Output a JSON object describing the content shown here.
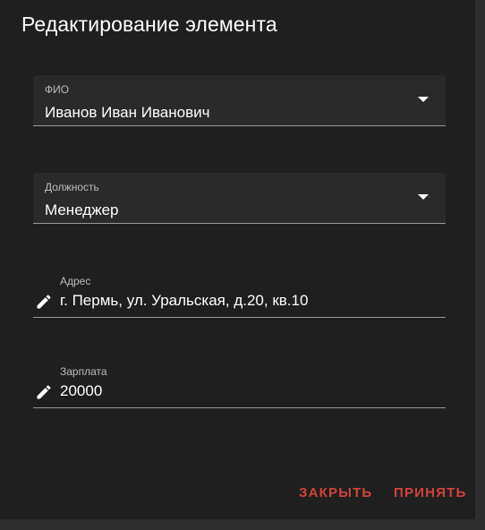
{
  "dialog": {
    "title": "Редактирование элемента"
  },
  "fields": {
    "fio": {
      "label": "ФИО",
      "value": "Иванов Иван Иванович"
    },
    "position": {
      "label": "Должность",
      "value": "Менеджер"
    },
    "address": {
      "label": "Адрес",
      "value": "г. Пермь, ул. Уральская, д.20, кв.10"
    },
    "salary": {
      "label": "Зарплата",
      "value": "20000"
    }
  },
  "actions": {
    "close_label": "ЗАКРЫТЬ",
    "accept_label": "ПРИНЯТЬ"
  },
  "colors": {
    "background": "#1f1f1f",
    "field_fill": "#2a2a2a",
    "accent": "#d2433a",
    "text": "#ffffff",
    "label": "#bdbdbd"
  },
  "icons": {
    "select_arrow": "arrow-drop-down-icon",
    "edit": "pencil-icon"
  }
}
